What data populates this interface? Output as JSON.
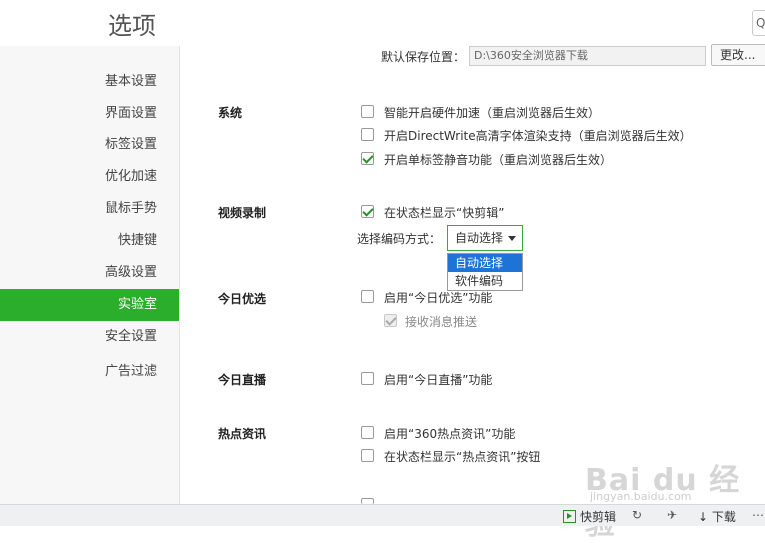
{
  "header": {
    "title": "选项",
    "search_glyph": "Q"
  },
  "sidebar": {
    "items": [
      {
        "label": "基本设置"
      },
      {
        "label": "界面设置"
      },
      {
        "label": "标签设置"
      },
      {
        "label": "优化加速"
      },
      {
        "label": "鼠标手势"
      },
      {
        "label": "快捷键"
      },
      {
        "label": "高级设置"
      },
      {
        "label": "实验室",
        "active": true
      },
      {
        "label": "安全设置"
      },
      {
        "label": "广告过滤"
      }
    ]
  },
  "download": {
    "label": "默认保存位置：",
    "path": "D:\\360安全浏览器下载",
    "change_label": "更改..."
  },
  "system": {
    "title": "系统",
    "options": [
      {
        "label": "智能开启硬件加速（重启浏览器后生效）",
        "checked": false
      },
      {
        "label": "开启DirectWrite高清字体渲染支持（重启浏览器后生效）",
        "checked": false
      },
      {
        "label": "开启单标签静音功能（重启浏览器后生效）",
        "checked": true
      }
    ]
  },
  "video": {
    "title": "视频录制",
    "option": {
      "label": "在状态栏显示“快剪辑”",
      "checked": true
    },
    "encode_label": "选择编码方式：",
    "encode_selected": "自动选择",
    "encode_options": [
      "自动选择",
      "软件编码"
    ]
  },
  "today_pick": {
    "title": "今日优选",
    "option": {
      "label": "启用“今日优选”功能",
      "checked": false
    },
    "sub_option": {
      "label": "接收消息推送",
      "checked": true,
      "disabled": true
    }
  },
  "today_live": {
    "title": "今日直播",
    "option": {
      "label": "启用“今日直播”功能",
      "checked": false
    }
  },
  "hot_news": {
    "title": "热点资讯",
    "options": [
      {
        "label": "启用“360热点资讯”功能",
        "checked": false
      },
      {
        "label": "在状态栏显示“热点资讯”按钮",
        "checked": false
      }
    ]
  },
  "statusbar": {
    "kuaijianji": "快剪辑",
    "download": "下载"
  },
  "watermark": {
    "main": "Bai du 经验",
    "sub": "jingyan.baidu.com"
  }
}
